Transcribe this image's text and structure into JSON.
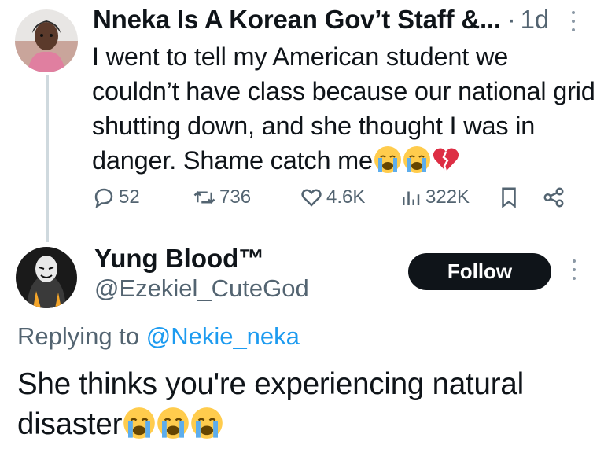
{
  "original_tweet": {
    "author_name": "Nneka Is A Korean Gov’t Staff &...",
    "time_separator": "·",
    "time": "1d",
    "text": "I went to tell my American student we couldn’t have class because our national grid shutting down, and she thought I was in danger. Shame catch me",
    "trailing_emojis": [
      "loudly-crying-face",
      "loudly-crying-face",
      "broken-heart"
    ],
    "stats": {
      "replies": "52",
      "reposts": "736",
      "likes": "4.6K",
      "views": "322K"
    }
  },
  "reply_tweet": {
    "author_name": "Yung Blood™",
    "handle": "@Ezekiel_CuteGod",
    "follow_label": "Follow",
    "replying_prefix": "Replying to",
    "replying_handle": "@Nekie_neka",
    "text": "She thinks you're experiencing natural disaster",
    "trailing_emojis": [
      "loudly-crying-face",
      "loudly-crying-face",
      "loudly-crying-face"
    ]
  },
  "colors": {
    "text": "#0f1419",
    "muted": "#536471",
    "link": "#1d9bf0",
    "button": "#0f1419",
    "thread_line": "#cfd9de"
  }
}
